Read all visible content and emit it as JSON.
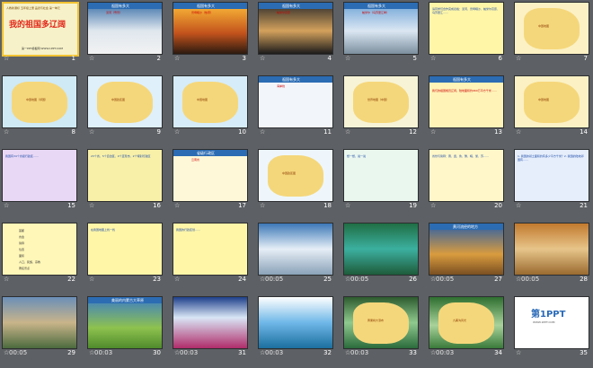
{
  "slides": [
    {
      "num": "1",
      "title": "我的祖国多辽阔",
      "subtitle": "人教新课标 五年级上册 品德与社会 第一单元",
      "footer": "第一PPT模板网 WWW.1PPT.COM"
    },
    {
      "num": "2",
      "header": "祖国有多大",
      "caption": "漠河（雪景）"
    },
    {
      "num": "3",
      "header": "祖国有多大",
      "caption": "曾母暗沙（热带）"
    },
    {
      "num": "4",
      "header": "祖国有多大",
      "caption": "帕米尔高原"
    },
    {
      "num": "5",
      "header": "祖国有多大",
      "caption": "帕米尔（乌苏里江畔）"
    },
    {
      "num": "6",
      "text": "请同学们合作完成表格：漠河、曾母暗沙、帕米尔高原、乌苏里江……"
    },
    {
      "num": "7",
      "caption": "中国地图"
    },
    {
      "num": "8",
      "caption": "中国地图（邻国）"
    },
    {
      "num": "9",
      "caption": "中国政区图"
    },
    {
      "num": "10",
      "caption": "中国地图"
    },
    {
      "num": "11",
      "header": "祖国有多大",
      "caption": "海岸线"
    },
    {
      "num": "12",
      "caption": "世界地图（中国）"
    },
    {
      "num": "13",
      "header": "祖国有多大",
      "text": "我们的祖国幅员辽阔，陆地面积约960万平方千米……"
    },
    {
      "num": "14",
      "caption": "中国地图"
    },
    {
      "num": "15",
      "text": "我国有34个省级行政区……"
    },
    {
      "num": "16",
      "text": "23个省、5个自治区、4个直辖市、2个特别行政区"
    },
    {
      "num": "17",
      "header": "省级行政区",
      "caption": "云南省"
    },
    {
      "num": "18",
      "caption": "中国政区图"
    },
    {
      "num": "19",
      "text": "想一想，说一说"
    },
    {
      "num": "20",
      "text": "省份与简称：晋、冀、鲁、豫、皖、浙、苏……"
    },
    {
      "num": "21",
      "text": "1. 我国的领土面积约有多少平方千米？2. 我国的陆地邻国有……"
    },
    {
      "num": "22",
      "items": [
        "首都",
        "省会",
        "简称",
        "位置",
        "面积",
        "人口、民族、宗教",
        "著名景点"
      ]
    },
    {
      "num": "23",
      "text": "在我国地图上找一找"
    },
    {
      "num": "24",
      "text": "我国的行政区划……"
    },
    {
      "num": "25",
      "duration": "00:05"
    },
    {
      "num": "26",
      "duration": "00:05"
    },
    {
      "num": "27",
      "duration": "00:05",
      "header": "黄河流经的地方"
    },
    {
      "num": "28",
      "duration": "00:05"
    },
    {
      "num": "29",
      "duration": "00:05"
    },
    {
      "num": "30",
      "duration": "00:03",
      "header": "美丽的内蒙古大草原"
    },
    {
      "num": "31",
      "duration": "00:03"
    },
    {
      "num": "32",
      "duration": "00:03"
    },
    {
      "num": "33",
      "duration": "00:03",
      "caption": "黄果树大瀑布"
    },
    {
      "num": "34",
      "duration": "00:03",
      "caption": "九寨沟风光"
    },
    {
      "num": "35",
      "brand": "第1PPT",
      "subtitle": "WWW.1PPT.COM"
    }
  ],
  "star_glyph": "☆"
}
